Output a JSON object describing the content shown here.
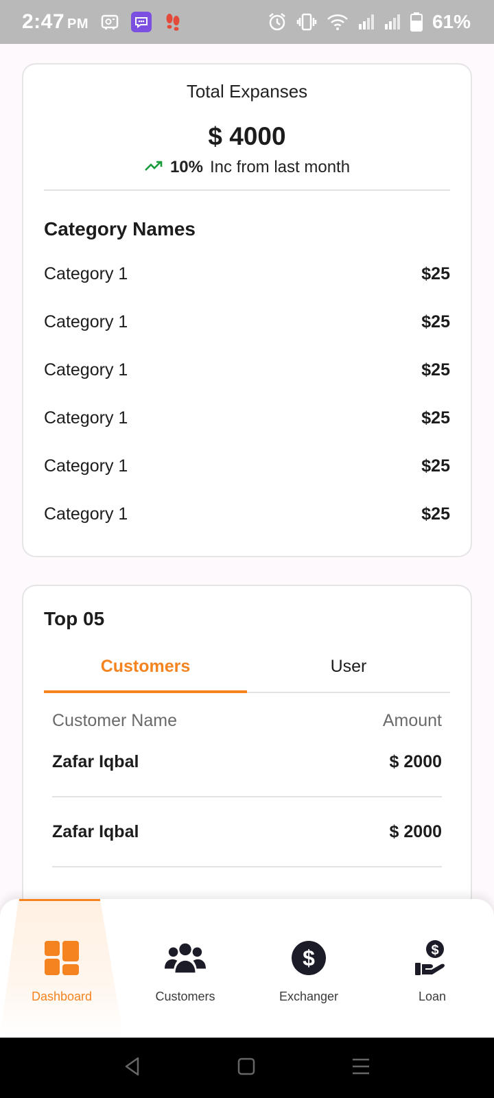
{
  "status_bar": {
    "time": "2:47",
    "ampm": "PM",
    "battery": "61%",
    "icons": [
      "storage-icon",
      "chat-app-icon",
      "footsteps-icon",
      "alarm-icon",
      "vibrate-icon",
      "wifi-icon",
      "signal-icon",
      "signal-icon",
      "battery-icon"
    ]
  },
  "expenses": {
    "title": "Total Expanses",
    "amount": "$ 4000",
    "change_pct": "10%",
    "change_text": "Inc from last month",
    "section_title": "Category Names",
    "categories": [
      {
        "name": "Category 1",
        "value": "$25"
      },
      {
        "name": "Category 1",
        "value": "$25"
      },
      {
        "name": "Category 1",
        "value": "$25"
      },
      {
        "name": "Category 1",
        "value": "$25"
      },
      {
        "name": "Category 1",
        "value": "$25"
      },
      {
        "name": "Category 1",
        "value": "$25"
      }
    ]
  },
  "top": {
    "title": "Top 05",
    "tabs": [
      {
        "label": "Customers",
        "active": true
      },
      {
        "label": "User",
        "active": false
      }
    ],
    "columns": {
      "name": "Customer Name",
      "amount": "Amount"
    },
    "rows": [
      {
        "name": "Zafar Iqbal",
        "amount": "$ 2000"
      },
      {
        "name": "Zafar Iqbal",
        "amount": "$ 2000"
      }
    ]
  },
  "bottom_nav": {
    "items": [
      {
        "label": "Dashboard",
        "icon": "dashboard-icon",
        "active": true
      },
      {
        "label": "Customers",
        "icon": "customers-icon",
        "active": false
      },
      {
        "label": "Exchanger",
        "icon": "dollar-circle-icon",
        "active": false
      },
      {
        "label": "Loan",
        "icon": "loan-hand-icon",
        "active": false
      }
    ]
  },
  "colors": {
    "accent": "#f5831f",
    "trend_up": "#1a9a3a",
    "status_bar": "#b9b9b9",
    "icon_dark": "#1c1c28"
  }
}
